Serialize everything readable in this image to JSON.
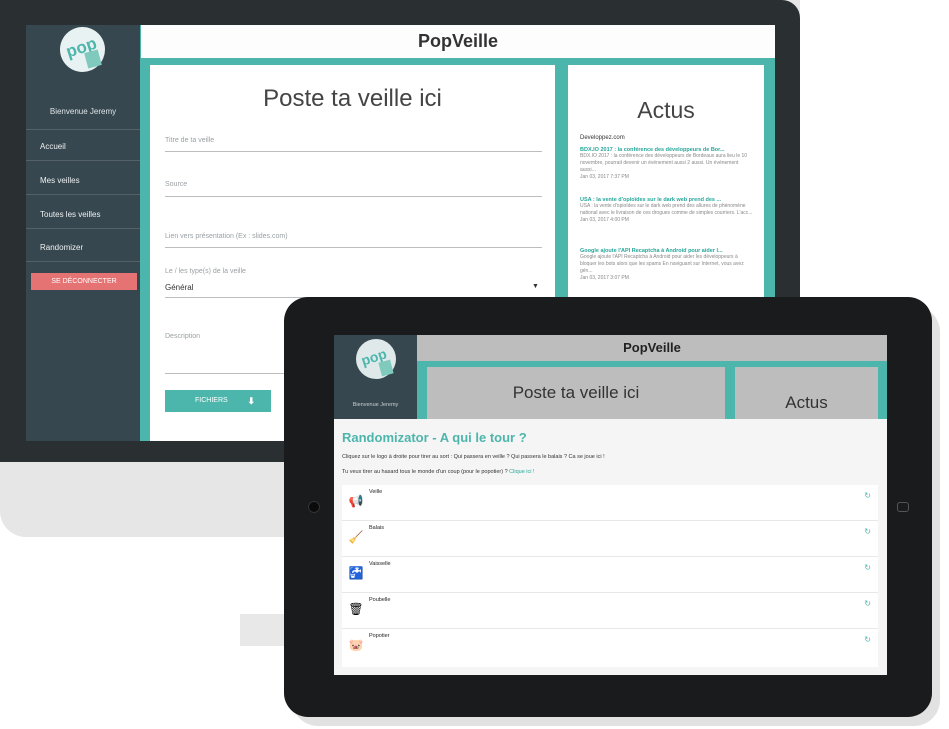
{
  "desktop": {
    "app_title": "PopVeille",
    "sidebar": {
      "logo_text": "pop",
      "welcome": "Bienvenue Jeremy",
      "nav": [
        "Accueil",
        "Mes veilles",
        "Toutes les veilles",
        "Randomizer"
      ],
      "logout": "SE DÉCONNECTER"
    },
    "form": {
      "title": "Poste ta veille ici",
      "fields": {
        "title_placeholder": "Titre de ta veille",
        "source_placeholder": "Source",
        "link_placeholder": "Lien vers présentation (Ex : slides.com)",
        "type_label": "Le / les type(s) de la veille",
        "type_value": "Général",
        "description_placeholder": "Description"
      },
      "files_button": "FICHIERS",
      "files_icon": "upload-arrow-icon"
    },
    "news": {
      "title": "Actus",
      "source": "Developpez.com",
      "items": [
        {
          "headline": "BDX.IO 2017 : la conférence des développeurs de Bor...",
          "summary": "BDX.IO 2017 : la conférence des développeurs de Bordeaux aura lieu le 10 novembre, pourrait devenir un événement aussi 2 aussi. Un événement aussi...",
          "date": "Jan 03, 2017 7:37 PM"
        },
        {
          "headline": "USA : la vente d'opioïdes sur le dark web prend des ...",
          "summary": "USA : la vente d'opioïdes sur le dark web prend des allures de phénomène national avec le livraison de ces drogues comme de simples courriers. L'acc...",
          "date": "Jan 03, 2017 4:00 PM"
        },
        {
          "headline": "Google ajoute l'API Recaptcha à Android pour aider l...",
          "summary": "Google ajoute l'API Recaptcha à Android pour aider les développeurs à bloquer les bots alors que les spams En naviguant sur Internet, vous avez gén...",
          "date": "Jan 03, 2017 3:07 PM"
        }
      ]
    }
  },
  "tablet": {
    "app_title": "PopVeille",
    "sidebar": {
      "logo_text": "pop",
      "welcome": "Bienvenue Jeremy"
    },
    "card_post": "Poste ta veille ici",
    "card_news": "Actus",
    "randomizer": {
      "title": "Randomizator - A qui le tour ?",
      "text1": "Cliquez sur le logo à droite pour tirer au sort : Qui passera en veille ? Qui passera le balais ? Ca se joue ici !",
      "text2_prefix": "Tu veux tirer au hasard tous le monde d'un coup (pour le popotier) ?",
      "text2_link": "Clique ici !",
      "items": [
        {
          "label": "Veille",
          "icon": "megaphone-icon"
        },
        {
          "label": "Balais",
          "icon": "broom-icon"
        },
        {
          "label": "Vaisselle",
          "icon": "faucet-icon"
        },
        {
          "label": "Poubelle",
          "icon": "trash-can-icon"
        },
        {
          "label": "Popotier",
          "icon": "piggy-bank-icon"
        }
      ],
      "refresh_icon": "refresh-icon"
    }
  },
  "colors": {
    "teal": "#4db6ac",
    "sidebar": "#37474f",
    "logout": "#e57373",
    "bezel": "#2a2f31",
    "tablet_frame": "#1a1b1c"
  }
}
